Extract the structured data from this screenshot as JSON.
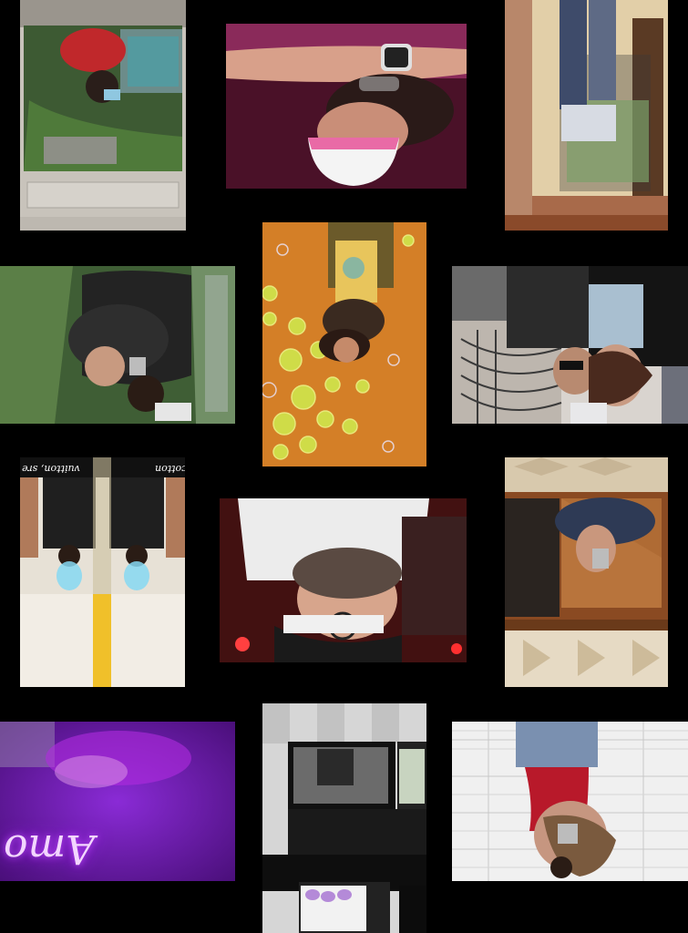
{
  "collage": {
    "photo_count": 12,
    "background_color": "#000000"
  },
  "photos": [
    {
      "subject": "mirror selfie with plants"
    },
    {
      "subject": "person with pink mask and watch"
    },
    {
      "subject": "mirror selfie on stairs"
    },
    {
      "subject": "two people in leather jackets with plants"
    },
    {
      "subject": "people against orange citrus wall"
    },
    {
      "subject": "two people selfie by railing"
    },
    {
      "subject": "two people mirror selfie with neon"
    },
    {
      "subject": "people under red light"
    },
    {
      "subject": "mirror selfie in wood frame"
    },
    {
      "subject": "purple neon sign"
    },
    {
      "subject": "mirror selfie with checkered floor"
    },
    {
      "subject": "mirror selfie with phone on tiles"
    }
  ],
  "signs": {
    "p7_left": "vuitton, sre",
    "p7_right": "cotton",
    "p10_neon": "Amo"
  }
}
